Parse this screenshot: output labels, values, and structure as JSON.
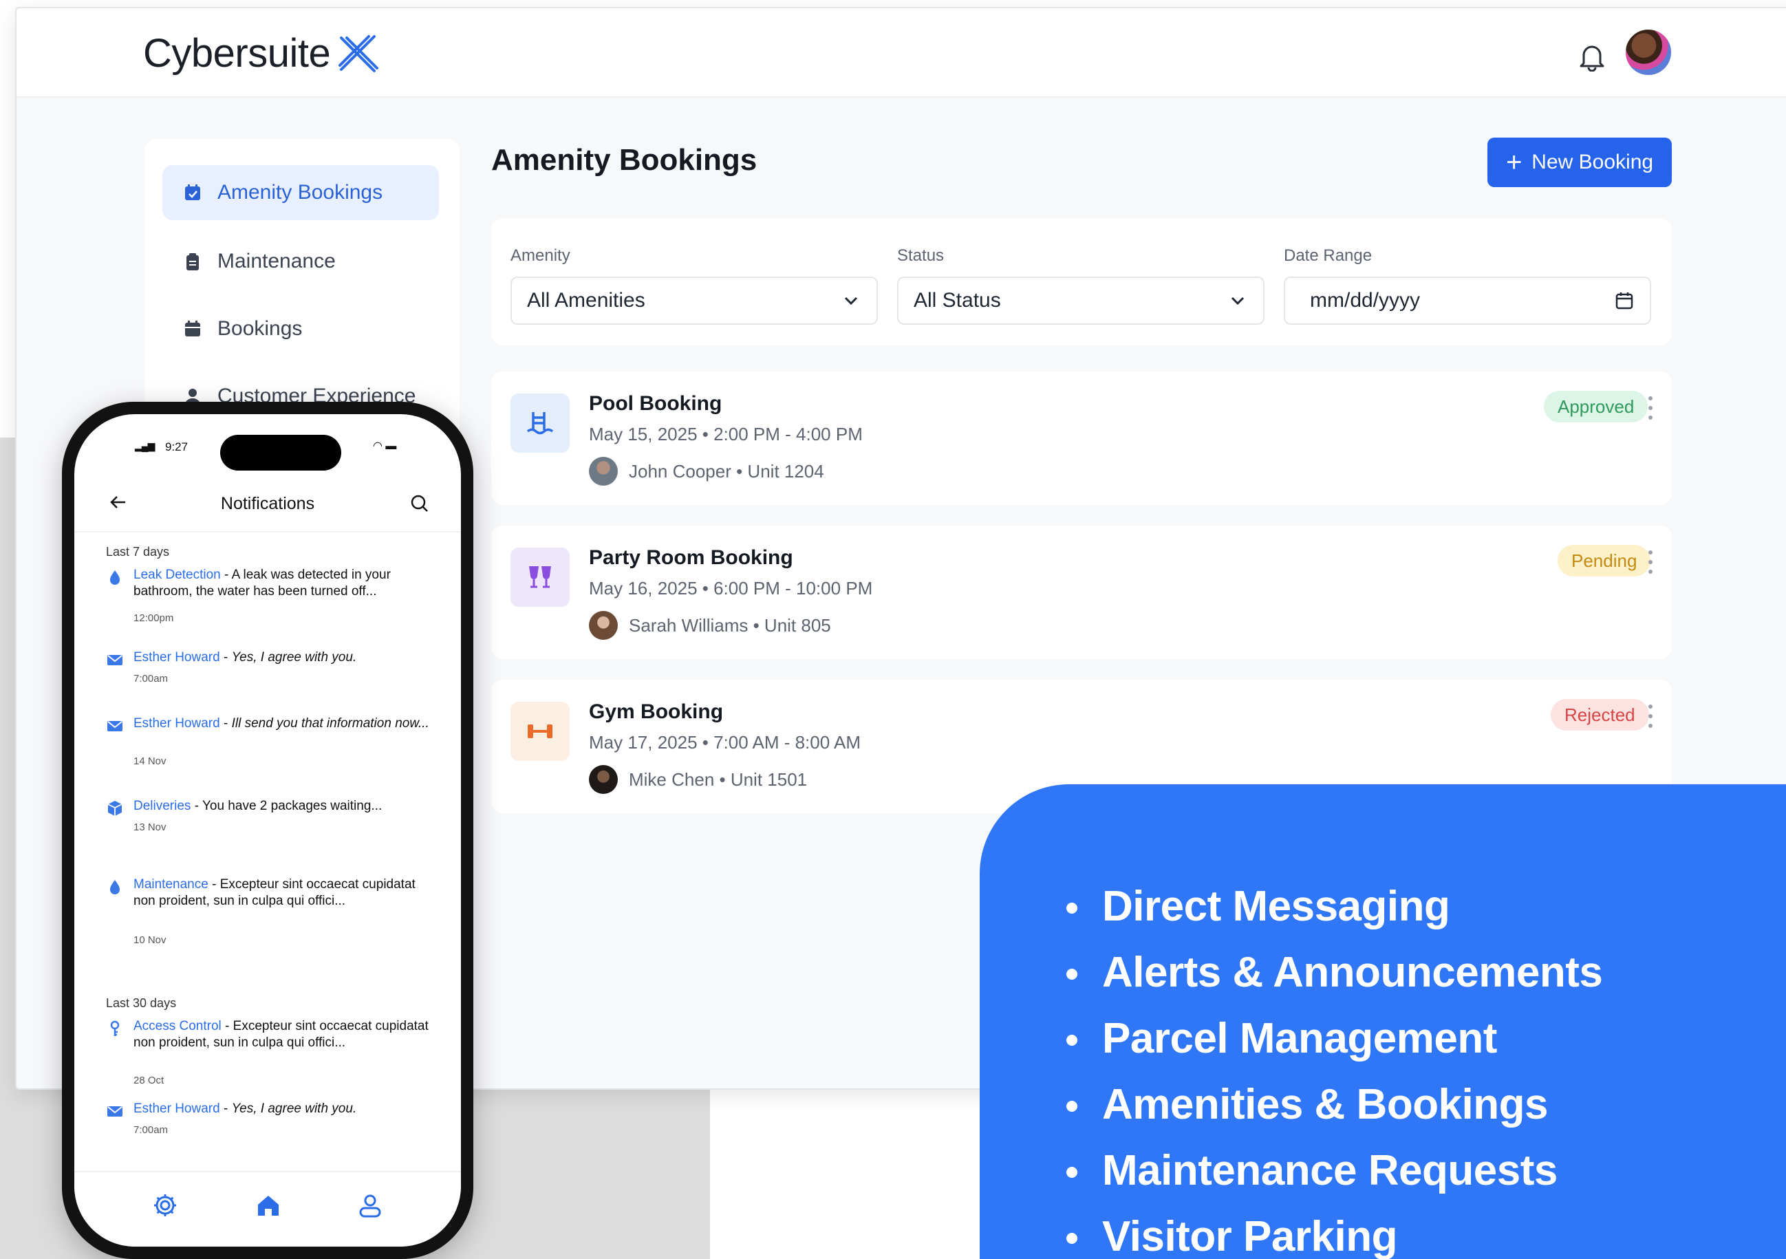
{
  "app": {
    "logo_text": "Cybersuite",
    "brand_color": "#2563eb",
    "icons": {
      "notification": "bell-icon",
      "profile": "avatar"
    }
  },
  "sidebar": {
    "items": [
      {
        "label": "Amenity Bookings",
        "icon": "calendar-check-icon",
        "active": true
      },
      {
        "label": "Maintenance",
        "icon": "clipboard-icon",
        "active": false
      },
      {
        "label": "Bookings",
        "icon": "calendar-icon",
        "active": false
      },
      {
        "label": "Customer Experience",
        "icon": "person-icon",
        "active": false
      }
    ]
  },
  "main": {
    "title": "Amenity Bookings",
    "new_button_label": "New Booking",
    "filters": {
      "amenity": {
        "label": "Amenity",
        "value": "All Amenities"
      },
      "status": {
        "label": "Status",
        "value": "All Status"
      },
      "date_range": {
        "label": "Date Range",
        "value": "mm/dd/yyyy"
      }
    },
    "bookings": [
      {
        "title": "Pool Booking",
        "time": "May 15, 2025 • 2:00 PM - 4:00 PM",
        "user": "John Cooper • Unit 1204",
        "status": "Approved",
        "icon": "pool-icon",
        "badge_bg": "#dcf5e6",
        "badge_color": "#2f9a5b",
        "icon_bg": "#e3edfb",
        "icon_color": "#2b6de8"
      },
      {
        "title": "Party Room Booking",
        "time": "May 16, 2025 • 6:00 PM - 10:00 PM",
        "user": "Sarah Williams • Unit 805",
        "status": "Pending",
        "icon": "party-glasses-icon",
        "badge_bg": "#fdf1c9",
        "badge_color": "#c58a12",
        "icon_bg": "#eee7fb",
        "icon_color": "#8b4fe0"
      },
      {
        "title": "Gym Booking",
        "time": "May 17, 2025 • 7:00 AM - 8:00 AM",
        "user": "Mike Chen • Unit 1501",
        "status": "Rejected",
        "icon": "dumbbell-icon",
        "badge_bg": "#fde2e2",
        "badge_color": "#d84545",
        "icon_bg": "#fdeee2",
        "icon_color": "#ea6a2a"
      }
    ]
  },
  "features": {
    "panel_color": "#2f77f6",
    "items": [
      "Direct Messaging",
      "Alerts & Announcements",
      "Parcel Management",
      "Amenities & Bookings",
      "Maintenance Requests",
      "Visitor Parking"
    ]
  },
  "phone": {
    "status_time": "9:27",
    "title": "Notifications",
    "sections": [
      {
        "label": "Last 7 days",
        "items": [
          {
            "icon": "droplet-icon",
            "title": "Leak Detection",
            "sep": " - ",
            "message": "A leak was detected in your bathroom, the water has been turned off...",
            "italic": false,
            "time": "12:00pm"
          },
          {
            "icon": "mail-icon",
            "title": "Esther Howard",
            "sep": " - ",
            "message": "Yes, I agree with you.",
            "italic": true,
            "time": "7:00am"
          },
          {
            "icon": "mail-icon",
            "title": "Esther Howard",
            "sep": " - ",
            "message": "Ill send you that information now...",
            "italic": true,
            "time": "14 Nov"
          },
          {
            "icon": "package-icon",
            "title": "Deliveries",
            "sep": " - ",
            "message": "You have 2 packages waiting...",
            "italic": false,
            "time": "13 Nov"
          },
          {
            "icon": "droplet-icon",
            "title": "Maintenance",
            "sep": " - ",
            "message": "Excepteur sint occaecat cupidatat non proident, sun in culpa qui offici...",
            "italic": false,
            "time": "10 Nov"
          }
        ]
      },
      {
        "label": "Last 30 days",
        "items": [
          {
            "icon": "key-icon",
            "title": "Access Control",
            "sep": " - ",
            "message": "Excepteur sint occaecat cupidatat non proident, sun in culpa qui offici...",
            "italic": false,
            "time": "28 Oct"
          },
          {
            "icon": "mail-icon",
            "title": "Esther Howard",
            "sep": " - ",
            "message": "Yes, I agree with you.",
            "italic": true,
            "time": "7:00am"
          }
        ]
      }
    ],
    "nav": [
      "settings-icon",
      "home-icon",
      "user-icon"
    ]
  }
}
